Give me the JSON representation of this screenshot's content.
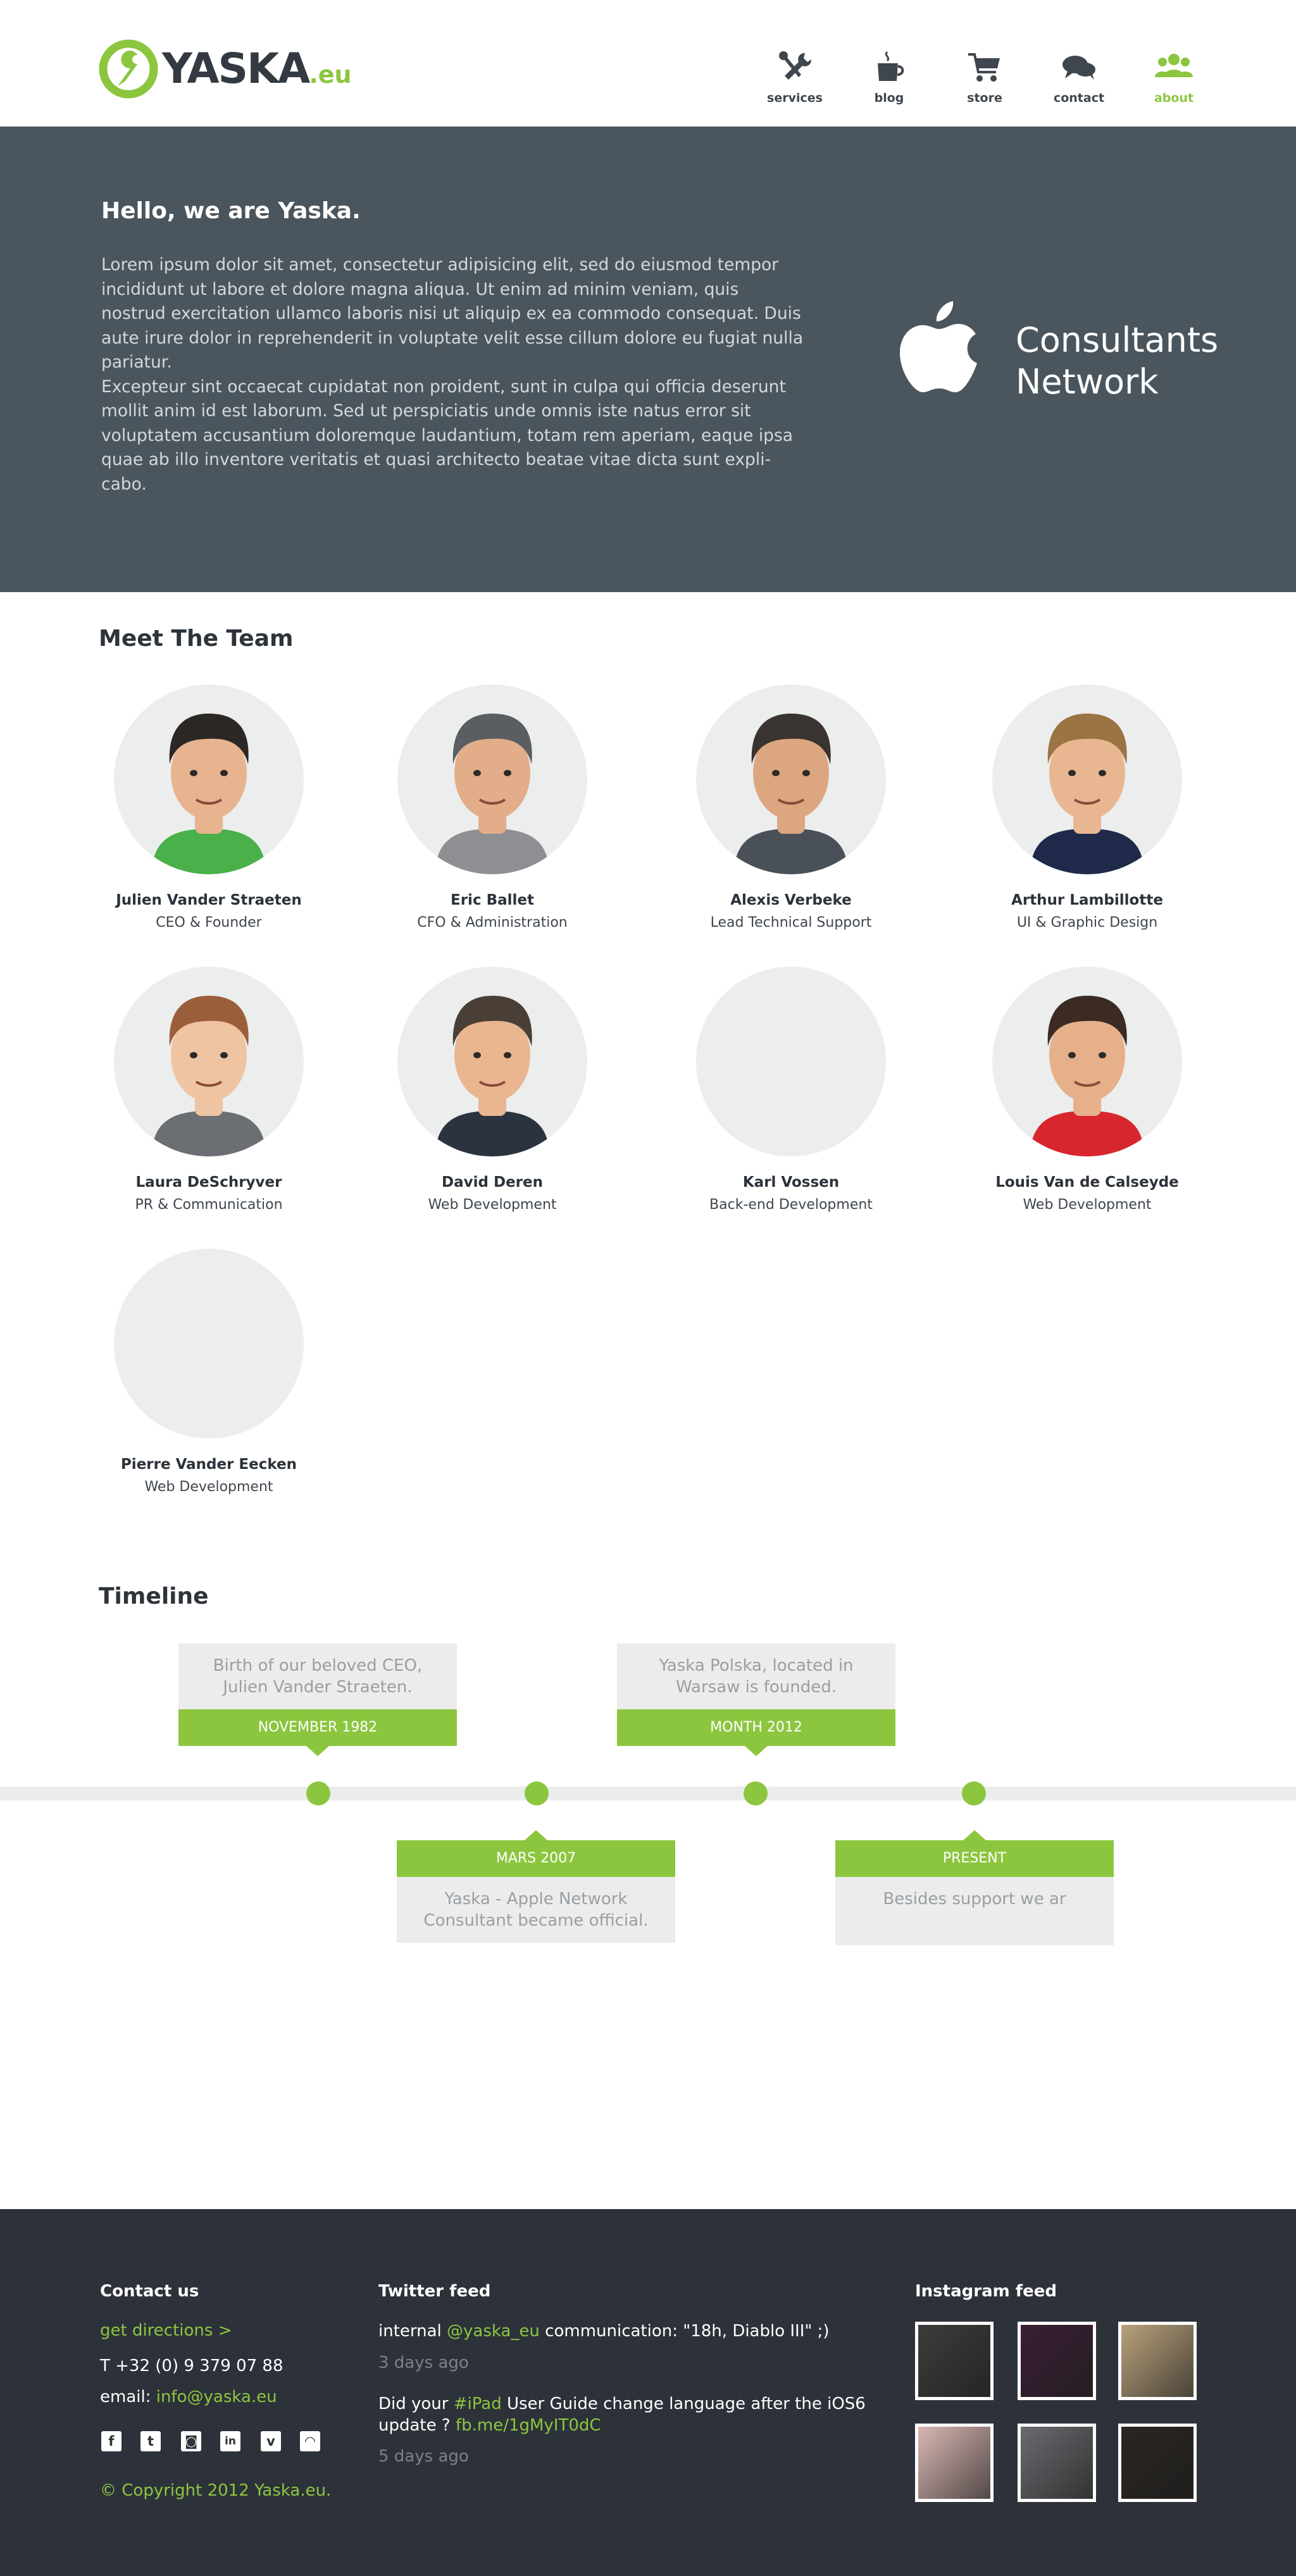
{
  "brand": {
    "name": "YASKA",
    "suffix": ".eu",
    "accent": "#8cc63f",
    "dark": "#333a41"
  },
  "nav": {
    "items": [
      {
        "label": "services",
        "icon": "tools-icon",
        "active": false
      },
      {
        "label": "blog",
        "icon": "coffee-cup-icon",
        "active": false
      },
      {
        "label": "store",
        "icon": "cart-icon",
        "active": false
      },
      {
        "label": "contact",
        "icon": "chat-bubbles-icon",
        "active": false
      },
      {
        "label": "about",
        "icon": "team-icon",
        "active": true
      }
    ]
  },
  "hero": {
    "title": "Hello, we are Yaska.",
    "paragraph1": "Lorem ipsum dolor sit amet, consectetur adipisicing elit, sed do eiusmod tempor incididunt ut labore et dolore magna aliqua. Ut enim ad minim veniam, quis nostrud exercitation ullamco laboris nisi ut aliquip ex ea commodo consequat. Duis aute irure dolor in reprehenderit in voluptate velit esse cillum dolore eu fugiat nulla pariatur.",
    "paragraph2": "Excepteur sint occaecat cupidatat non proident, sunt in culpa qui officia deserunt mollit anim id est laborum. Sed ut perspiciatis unde omnis iste natus error sit voluptatem accusantium doloremque laudantium, totam rem aperiam, eaque ipsa quae ab illo inventore veritatis et quasi architecto beatae vitae dicta sunt expli-cabo.",
    "badge_line1": "Consultants",
    "badge_line2": "Network",
    "badge_icon": "apple-logo-icon",
    "background": "#4b555d"
  },
  "team": {
    "title": "Meet The Team",
    "members": [
      {
        "name": "Julien Vander Straeten",
        "role": "CEO & Founder",
        "hair": "#2b2724",
        "shirt": "#49b04a",
        "skin": "#e7b48f",
        "has_avatar": true
      },
      {
        "name": "Eric Ballet",
        "role": "CFO & Administration",
        "hair": "#5a5e62",
        "shirt": "#8d8f92",
        "skin": "#e2ad88",
        "has_avatar": true
      },
      {
        "name": "Alexis Verbeke",
        "role": "Lead Technical Support",
        "hair": "#3a3430",
        "shirt": "#4a5058",
        "skin": "#dca680",
        "has_avatar": true
      },
      {
        "name": "Arthur Lambillotte",
        "role": "UI & Graphic Design",
        "hair": "#9b7443",
        "shirt": "#1f2a4a",
        "skin": "#e8b792",
        "has_avatar": true
      },
      {
        "name": "Laura DeSchryver",
        "role": "PR & Communication",
        "hair": "#9a5f3a",
        "shirt": "#6b6f73",
        "skin": "#efc4a2",
        "has_avatar": true
      },
      {
        "name": "David Deren",
        "role": "Web Development",
        "hair": "#4a3f36",
        "shirt": "#2c3340",
        "skin": "#e9b690",
        "has_avatar": true
      },
      {
        "name": "Karl Vossen",
        "role": "Back-end Development",
        "has_avatar": false
      },
      {
        "name": "Louis Van de Calseyde",
        "role": "Web Development",
        "hair": "#3b2b22",
        "shirt": "#d8262f",
        "skin": "#e5b08a",
        "has_avatar": true
      },
      {
        "name": "Pierre Vander Eecken",
        "role": "Web Development",
        "has_avatar": false
      }
    ]
  },
  "timeline": {
    "title": "Timeline",
    "events": [
      {
        "date": "NOVEMBER 1982",
        "desc": "Birth of our beloved CEO, Julien Vander Straeten.",
        "position": "above"
      },
      {
        "date": "MARS 2007",
        "desc": "Yaska - Apple Network Consultant became official.",
        "position": "below"
      },
      {
        "date": "MONTH 2012",
        "desc": "Yaska Polska, located in Warsaw is founded.",
        "position": "above"
      },
      {
        "date": "PRESENT",
        "desc": "Besides support we ar",
        "position": "below"
      }
    ]
  },
  "footer": {
    "contact_title": "Contact us",
    "directions": "get directions >",
    "phone": "T +32 (0) 9 379 07 88",
    "email_label": "email: ",
    "email": "info@yaska.eu",
    "social": [
      {
        "icon": "facebook-icon",
        "glyph": "f"
      },
      {
        "icon": "twitter-icon",
        "glyph": "t"
      },
      {
        "icon": "instagram-icon",
        "glyph": "◙"
      },
      {
        "icon": "linkedin-icon",
        "glyph": "in"
      },
      {
        "icon": "vimeo-icon",
        "glyph": "v"
      },
      {
        "icon": "rss-icon",
        "glyph": "◠"
      }
    ],
    "copyright": "© Copyright 2012 Yaska.eu.",
    "twitter_title": "Twitter feed",
    "tweets": [
      {
        "before": "internal ",
        "highlight": "@yaska_eu",
        "after": " communication: \"18h, Diablo III\" ;)",
        "time": "3 days ago"
      },
      {
        "before": "Did your ",
        "highlight": "#iPad",
        "after": " User Guide change language after the iOS6 update ? ",
        "link": "fb.me/1gMyIT0dC",
        "time": "5 days ago"
      }
    ],
    "instagram_title": "Instagram feed",
    "photos": [
      "#3c3c3c",
      "#3a1f34",
      "#b9a27c",
      "#d9b7b3",
      "#6a6b6f",
      "#2a2622"
    ]
  }
}
